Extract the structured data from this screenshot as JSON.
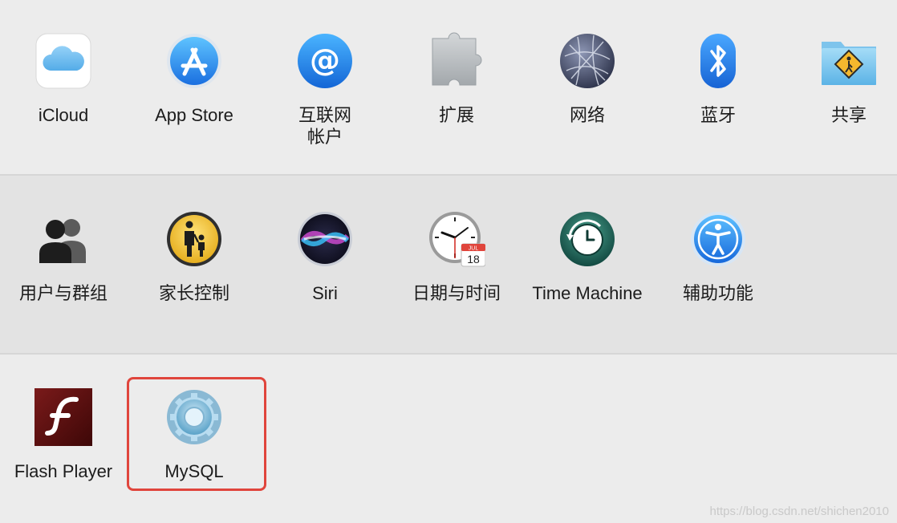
{
  "rows": [
    {
      "items": [
        {
          "label": "iCloud",
          "icon": "icloud-icon"
        },
        {
          "label": "App Store",
          "icon": "app-store-icon"
        },
        {
          "label": "互联网\n帐户",
          "icon": "internet-accounts-icon"
        },
        {
          "label": "扩展",
          "icon": "extensions-icon"
        },
        {
          "label": "网络",
          "icon": "network-icon"
        },
        {
          "label": "蓝牙",
          "icon": "bluetooth-icon"
        },
        {
          "label": "共享",
          "icon": "sharing-icon"
        }
      ]
    },
    {
      "items": [
        {
          "label": "用户与群组",
          "icon": "users-groups-icon"
        },
        {
          "label": "家长控制",
          "icon": "parental-controls-icon"
        },
        {
          "label": "Siri",
          "icon": "siri-icon"
        },
        {
          "label": "日期与时间",
          "icon": "date-time-icon"
        },
        {
          "label": "Time Machine",
          "icon": "time-machine-icon"
        },
        {
          "label": "辅助功能",
          "icon": "accessibility-icon"
        }
      ]
    },
    {
      "items": [
        {
          "label": "Flash Player",
          "icon": "flash-player-icon"
        },
        {
          "label": "MySQL",
          "icon": "mysql-icon",
          "highlighted": true
        }
      ]
    }
  ],
  "calendar": {
    "month": "JUL",
    "day": "18"
  },
  "highlight_color": "#e0453c",
  "watermark": "https://blog.csdn.net/shichen2010"
}
